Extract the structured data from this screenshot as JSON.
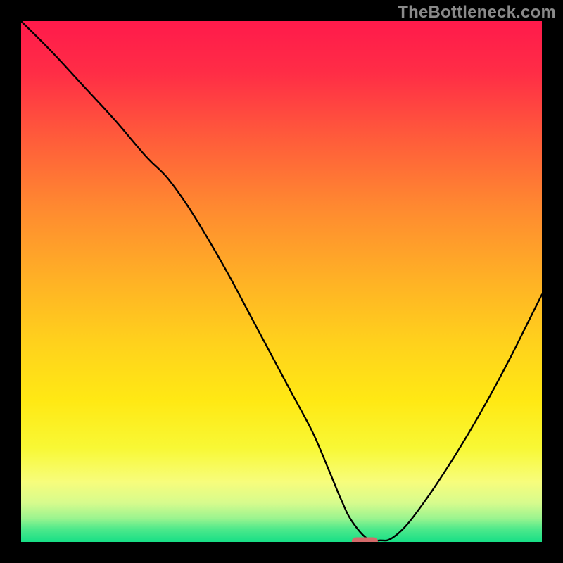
{
  "watermark": "TheBottleneck.com",
  "colors": {
    "gradient_stops": [
      {
        "offset": 0.0,
        "color": "#ff1a4b"
      },
      {
        "offset": 0.1,
        "color": "#ff2d46"
      },
      {
        "offset": 0.22,
        "color": "#ff5a3b"
      },
      {
        "offset": 0.36,
        "color": "#ff8a30"
      },
      {
        "offset": 0.5,
        "color": "#ffb225"
      },
      {
        "offset": 0.62,
        "color": "#ffd21c"
      },
      {
        "offset": 0.73,
        "color": "#ffe914"
      },
      {
        "offset": 0.82,
        "color": "#f8f835"
      },
      {
        "offset": 0.885,
        "color": "#f7fd7c"
      },
      {
        "offset": 0.925,
        "color": "#d7fb8d"
      },
      {
        "offset": 0.955,
        "color": "#9af48f"
      },
      {
        "offset": 0.975,
        "color": "#4fe98b"
      },
      {
        "offset": 1.0,
        "color": "#17df86"
      }
    ],
    "marker": "#d46a6a",
    "curve": "#000000"
  },
  "chart_data": {
    "type": "line",
    "title": "",
    "xlabel": "",
    "ylabel": "",
    "xlim": [
      0,
      100
    ],
    "ylim": [
      0,
      100
    ],
    "x": [
      0,
      6,
      12,
      18,
      24,
      28,
      32,
      36,
      40,
      44,
      48,
      52,
      56,
      59,
      61.5,
      63.5,
      66.5,
      69,
      71,
      74,
      78,
      82,
      86,
      90,
      94,
      97,
      100
    ],
    "values": [
      100,
      94,
      87.5,
      81,
      74,
      70,
      64.5,
      58,
      51,
      43.5,
      36,
      28.5,
      21,
      14,
      8,
      4,
      0.6,
      0.3,
      0.6,
      3.2,
      8.5,
      14.5,
      21,
      28,
      35.5,
      41.5,
      47.5
    ],
    "marker": {
      "x_start": 63.5,
      "x_end": 68.5,
      "y": 0
    }
  }
}
